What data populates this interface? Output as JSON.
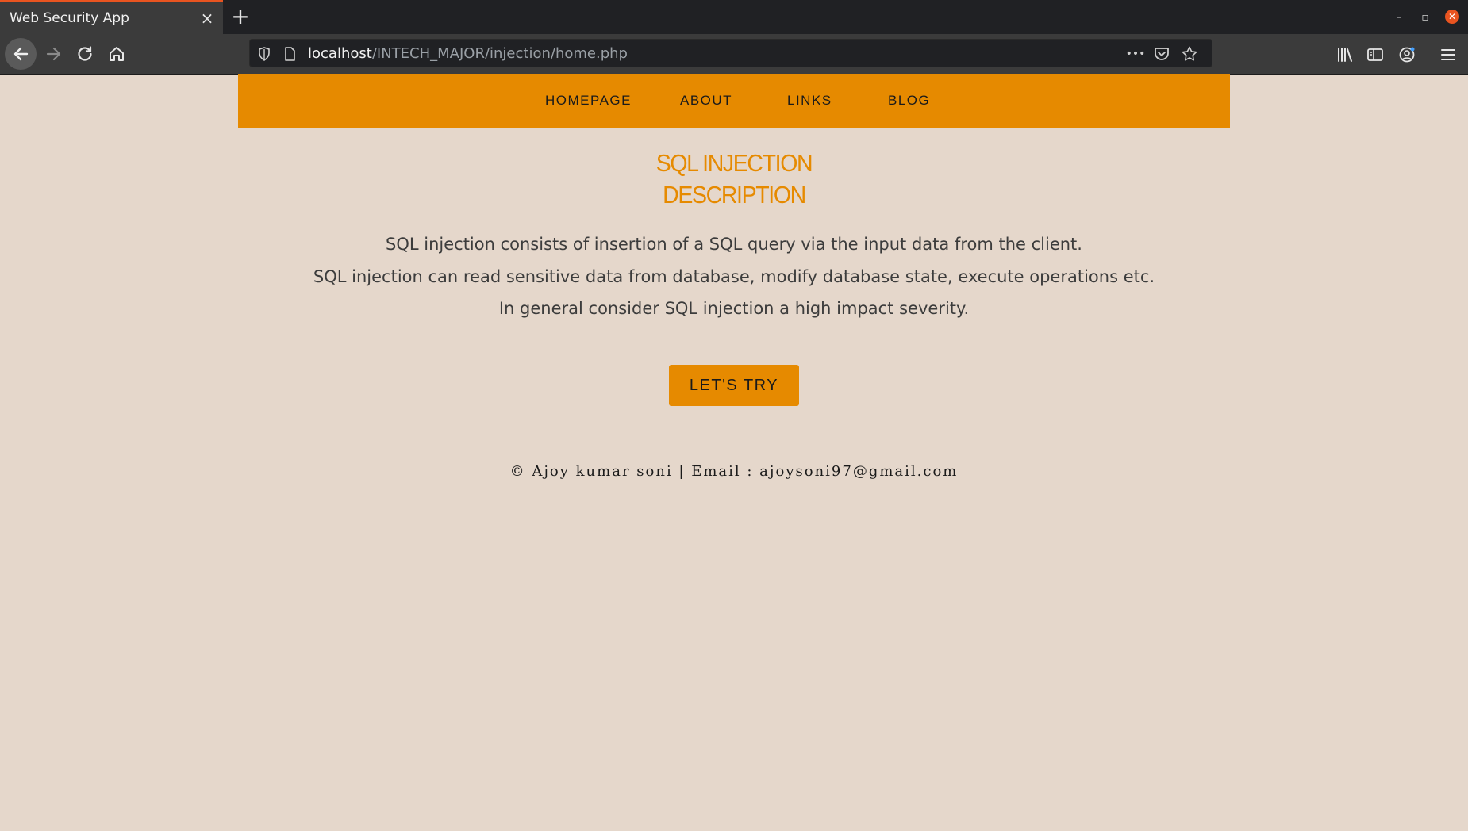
{
  "browser": {
    "tab_title": "Web Security App",
    "tab_close": "×",
    "new_tab": "+",
    "url_host": "localhost",
    "url_path": "/INTECH_MAJOR/injection/home.php",
    "page_actions": "•••"
  },
  "site": {
    "nav": [
      "HOMEPAGE",
      "ABOUT",
      "LINKS",
      "BLOG"
    ],
    "heading_line1": "SQL INJECTION",
    "heading_line2": "DESCRIPTION",
    "desc": [
      "SQL injection consists of insertion of a SQL query via the input data from the client.",
      "SQL injection can read sensitive data from database, modify database state, execute operations etc.",
      "In general consider SQL injection a high impact severity."
    ],
    "cta": "LET'S TRY",
    "footer": "© Ajoy kumar soni | Email : ajoysoni97@gmail.com"
  },
  "colors": {
    "accent": "#e68a00",
    "page_bg": "#e5d7cb",
    "browser_accent": "#e95420"
  },
  "icons": [
    "back-icon",
    "forward-icon",
    "reload-icon",
    "home-icon",
    "shield-icon",
    "page-icon",
    "more-icon",
    "pocket-icon",
    "star-icon",
    "library-icon",
    "sidebar-icon",
    "account-icon",
    "menu-icon"
  ]
}
